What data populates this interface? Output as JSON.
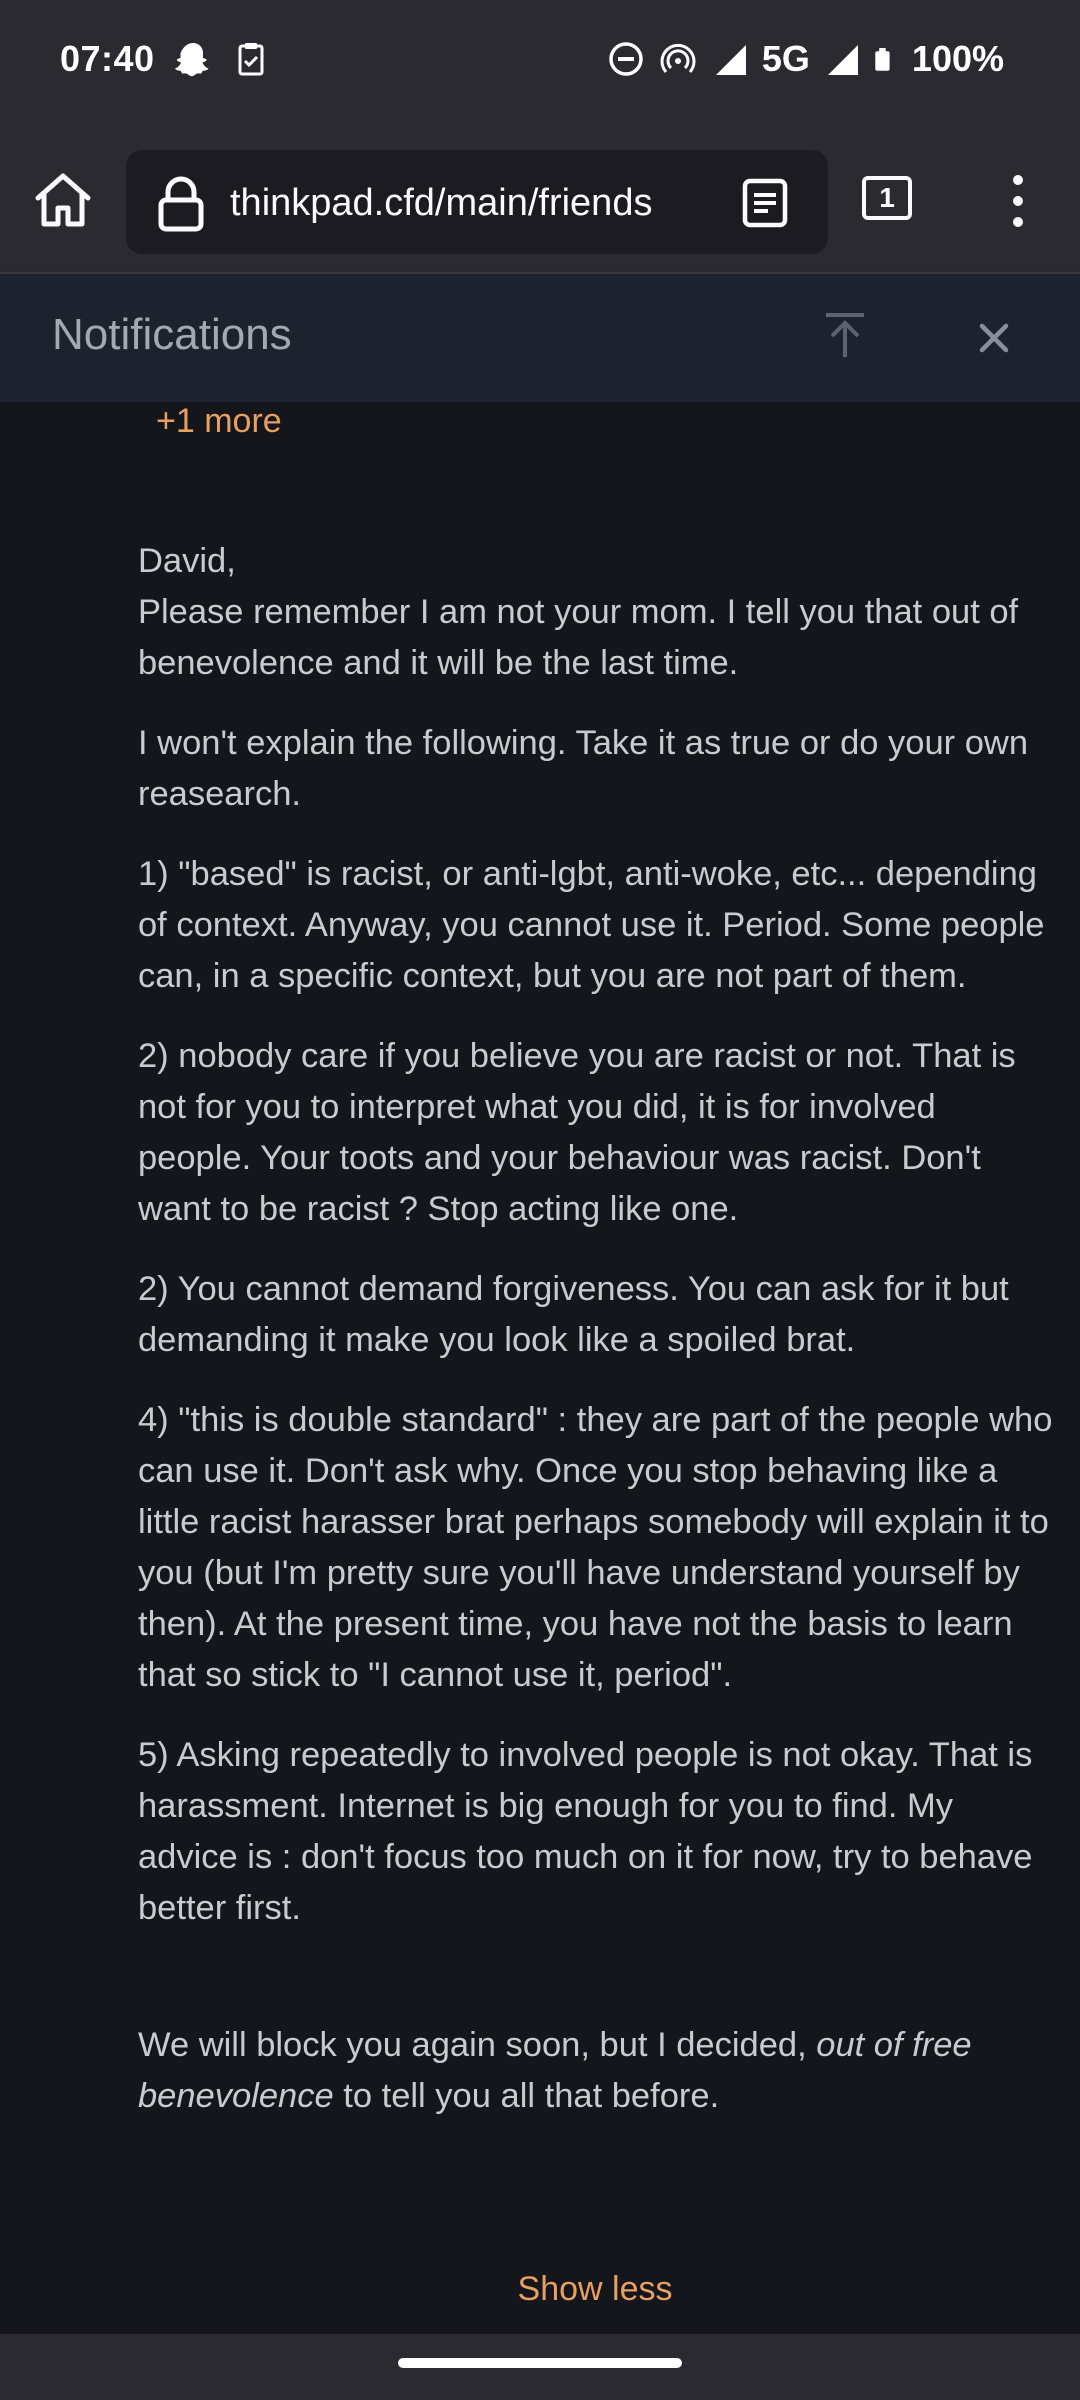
{
  "status_bar": {
    "time": "07:40",
    "network": "5G",
    "battery": "100%",
    "icons": [
      "snapchat-icon",
      "clipboard-check-icon",
      "do-not-disturb-icon",
      "hotspot-icon",
      "signal-icon",
      "signal-icon",
      "battery-icon"
    ]
  },
  "browser": {
    "url": "thinkpad.cfd/main/friends",
    "tab_count": "1",
    "icons": [
      "home-icon",
      "lock-icon",
      "reader-mode-icon",
      "tabs-icon",
      "kebab-menu-icon"
    ]
  },
  "notifications": {
    "title": "Notifications",
    "icons": [
      "scroll-to-top-icon",
      "close-icon"
    ]
  },
  "post": {
    "more_link": "+1 more",
    "greeting": "David,",
    "intro": "Please remember I am not your mom. I tell you that out of benevolence and it will be the last time.",
    "para1": "I won't explain the following. Take it as true or do your own reasearch.",
    "para2": "1) \"based\" is racist, or anti-lgbt, anti-woke, etc... depending of context. Anyway, you cannot use it. Period. Some people can, in a specific context, but you are not part of them.",
    "para3": "2) nobody care if you believe you are racist or not. That is not for you to interpret what you did, it is for involved people. Your toots and your behaviour was racist. Don't want to be racist ? Stop acting like one.",
    "para4": "2) You cannot demand forgiveness. You can ask for it but demanding it make you look like a spoiled brat.",
    "para5": "4) \"this is double standard\" : they are part of the people who can use it. Don't ask why. Once you stop behaving like a little racist harasser brat perhaps somebody will explain it to you (but I'm pretty sure you'll have understand yourself by then). At the present time, you have not the basis to learn that so stick to \"I cannot use it, period\".",
    "para6": "5) Asking repeatedly to involved people is not okay. That is harassment. Internet is big enough for you to find. My advice is : don't focus too much on it for now, try to behave better first.",
    "closing_start": "We will block you again soon, but I decided, ",
    "closing_em": "out of free benevolence",
    "closing_end": " to tell you all that before.",
    "show_less": "Show less"
  },
  "colors": {
    "accent": "#e7a060",
    "background": "#14161c",
    "header": "#1d232e",
    "chrome": "#2b2a31"
  }
}
